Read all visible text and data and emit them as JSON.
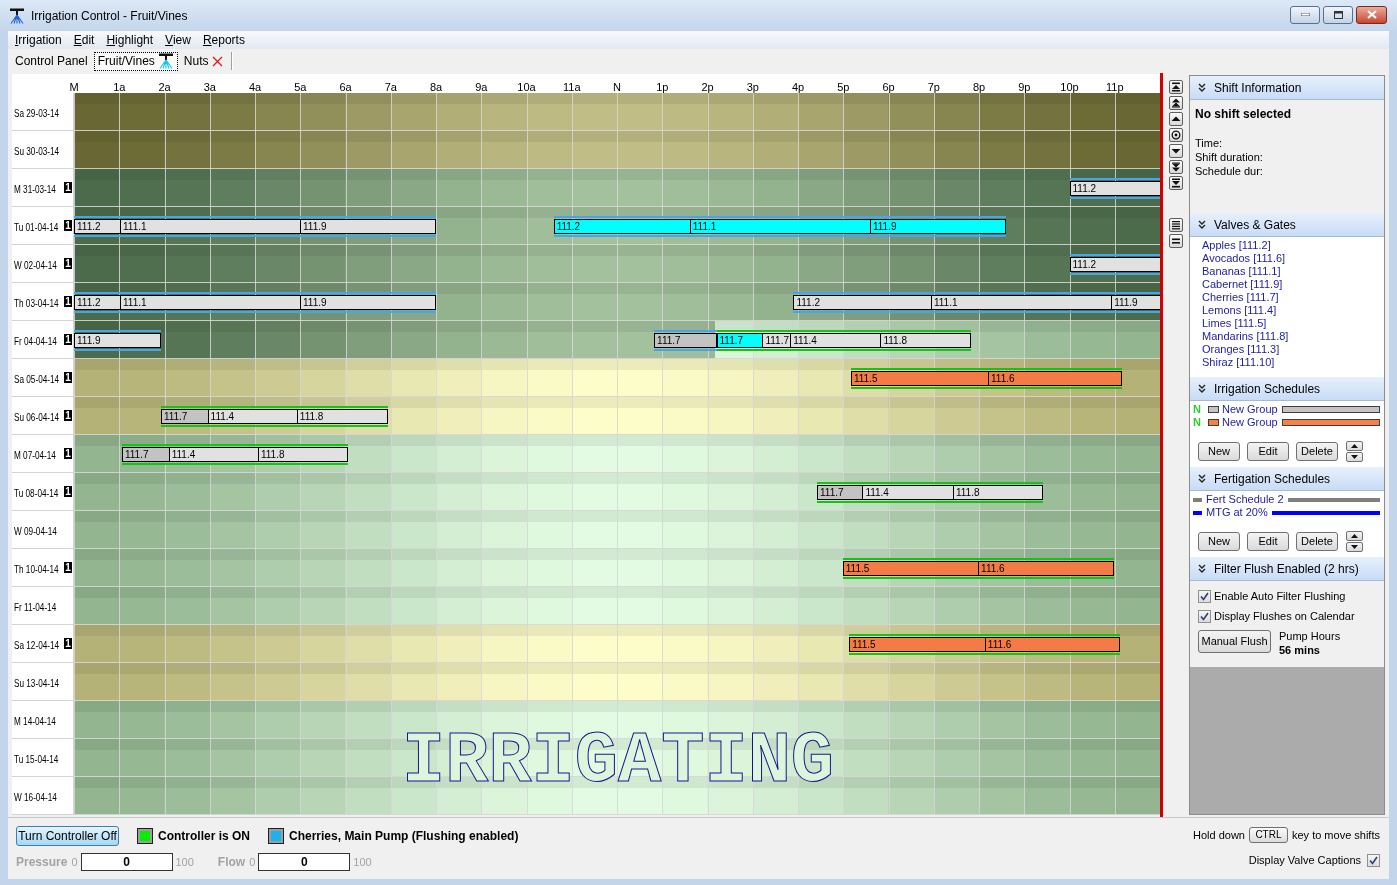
{
  "window": {
    "title": "Irrigation Control - Fruit/Vines"
  },
  "menu": [
    "Irrigation",
    "Edit",
    "Highlight",
    "View",
    "Reports"
  ],
  "tabs": [
    {
      "label": "Control Panel",
      "selected": false,
      "kind": "plain"
    },
    {
      "label": "Fruit/Vines",
      "selected": true,
      "kind": "sprinkler"
    },
    {
      "label": "Nuts",
      "selected": false,
      "kind": "closable"
    }
  ],
  "calendar": {
    "hours": [
      "M",
      "1a",
      "2a",
      "3a",
      "4a",
      "5a",
      "6a",
      "7a",
      "8a",
      "9a",
      "10a",
      "11a",
      "N",
      "1p",
      "2p",
      "3p",
      "4p",
      "5p",
      "6p",
      "7p",
      "8p",
      "9p",
      "10p",
      "11p"
    ],
    "rows": [
      {
        "label": "Sa 29-03-14",
        "kind": "weekend",
        "level": 1
      },
      {
        "label": "Su 30-03-14",
        "kind": "weekend",
        "level": 1
      },
      {
        "label": "M 31-03-14",
        "kind": "weekday",
        "level": 1,
        "badge": "1",
        "shifts": [
          {
            "color": "#e1e1e1",
            "band": {
              "color": "#43a6ee"
            },
            "segments": [
              {
                "label": "111.2",
                "kind": "plain"
              }
            ]
          }
        ]
      },
      {
        "label": "Tu 01-04-14",
        "kind": "weekday",
        "level": 1,
        "badge": "1",
        "shifts": [
          {
            "color": "#e1e1e1",
            "band": {
              "color": "#43a6ee"
            },
            "segments": [
              {
                "label": "111.2",
                "kind": "plain"
              },
              {
                "label": "111.1",
                "kind": "plain"
              },
              {
                "label": "111.9",
                "kind": "plain"
              }
            ]
          },
          {
            "band": {
              "color": "#43a6ee"
            },
            "segments": [
              {
                "label": "111.2",
                "kind": "active"
              },
              {
                "label": "111.1",
                "kind": "active"
              },
              {
                "label": "111.9",
                "kind": "active"
              }
            ]
          }
        ]
      },
      {
        "label": "W 02-04-14",
        "kind": "weekday",
        "level": 1,
        "badge": "1",
        "shifts": [
          {
            "color": "#e1e1e1",
            "band": {
              "color": "#43a6ee"
            },
            "segments": [
              {
                "label": "111.2",
                "kind": "plain"
              }
            ]
          }
        ]
      },
      {
        "label": "Th 03-04-14",
        "kind": "weekday",
        "level": 1,
        "badge": "1",
        "shifts": [
          {
            "color": "#e1e1e1",
            "band": {
              "color": "#43a6ee"
            },
            "segments": [
              {
                "label": "111.2",
                "kind": "plain"
              },
              {
                "label": "111.1",
                "kind": "plain"
              },
              {
                "label": "111.9",
                "kind": "plain"
              }
            ]
          },
          {
            "color": "#e1e1e1",
            "band": {
              "color": "#43a6ee"
            },
            "segments": [
              {
                "label": "111.2",
                "kind": "plain"
              },
              {
                "label": "111.1",
                "kind": "plain"
              },
              {
                "label": "111.9",
                "kind": "plain"
              }
            ]
          }
        ]
      },
      {
        "label": "Fr 04-04-14",
        "kind": "weekday",
        "level": 0.59,
        "badge": "1",
        "shifts": [
          {
            "color": "#e1e1e1",
            "band": {
              "color": "#43a6ee"
            },
            "segments": [
              {
                "label": "111.9",
                "kind": "plain"
              }
            ]
          },
          {
            "band": {
              "color": "#43a6ee"
            },
            "segments": [
              {
                "label": "111.7",
                "kind": "shaded"
              }
            ]
          },
          {
            "color": "#e1e1e1",
            "band": {
              "color": "#14c414"
            },
            "segments": [
              {
                "label": "111.7",
                "kind": "active"
              },
              {
                "label": "111.7",
                "kind": "plain"
              },
              {
                "label": "111.4",
                "kind": "plain"
              },
              {
                "label": "111.8",
                "kind": "plain"
              }
            ]
          }
        ]
      },
      {
        "label": "Sa 05-04-14",
        "kind": "weekend",
        "badge": "1",
        "shifts": [
          {
            "color": "#f57b46",
            "band": {
              "color": "#14c414"
            },
            "segments": [
              {
                "label": "111.5",
                "kind": "plain"
              },
              {
                "label": "111.6",
                "kind": "plain"
              }
            ]
          }
        ]
      },
      {
        "label": "Su 06-04-14",
        "kind": "weekend",
        "badge": "1",
        "shifts": [
          {
            "color": "#e1e1e1",
            "band": {
              "color": "#14c414"
            },
            "segments": [
              {
                "label": "111.7",
                "kind": "shaded"
              },
              {
                "label": "111.4",
                "kind": "plain"
              },
              {
                "label": "111.8",
                "kind": "plain"
              }
            ]
          }
        ]
      },
      {
        "label": "M 07-04-14",
        "kind": "weekday",
        "badge": "1",
        "shifts": [
          {
            "color": "#e1e1e1",
            "band": {
              "color": "#14c414"
            },
            "segments": [
              {
                "label": "111.7",
                "kind": "shaded"
              },
              {
                "label": "111.4",
                "kind": "plain"
              },
              {
                "label": "111.8",
                "kind": "plain"
              }
            ]
          }
        ]
      },
      {
        "label": "Tu 08-04-14",
        "kind": "weekday",
        "badge": "1",
        "shifts": [
          {
            "color": "#e1e1e1",
            "band": {
              "color": "#14c414"
            },
            "segments": [
              {
                "label": "111.7",
                "kind": "shaded"
              },
              {
                "label": "111.4",
                "kind": "plain"
              },
              {
                "label": "111.8",
                "kind": "plain"
              }
            ]
          }
        ]
      },
      {
        "label": "W 09-04-14",
        "kind": "weekday"
      },
      {
        "label": "Th 10-04-14",
        "kind": "weekday",
        "badge": "1",
        "shifts": [
          {
            "color": "#f57b46",
            "band": {
              "color": "#14c414"
            },
            "segments": [
              {
                "label": "111.5",
                "kind": "plain"
              },
              {
                "label": "111.6",
                "kind": "plain"
              }
            ]
          }
        ]
      },
      {
        "label": "Fr 11-04-14",
        "kind": "weekday"
      },
      {
        "label": "Sa 12-04-14",
        "kind": "weekend",
        "badge": "1",
        "shifts": [
          {
            "color": "#f57b46",
            "band": {
              "color": "#14c414"
            },
            "segments": [
              {
                "label": "111.5",
                "kind": "plain"
              },
              {
                "label": "111.6",
                "kind": "plain"
              }
            ]
          }
        ]
      },
      {
        "label": "Su 13-04-14",
        "kind": "weekend"
      },
      {
        "label": "M 14-04-14",
        "kind": "weekday"
      },
      {
        "label": "Tu 15-04-14",
        "kind": "weekday"
      },
      {
        "label": "W 16-04-14",
        "kind": "weekday"
      }
    ],
    "status_text": "IRRIGATING"
  },
  "side_panel": {
    "shift_info": {
      "title": "Shift Information",
      "heading": "No shift selected",
      "fields": [
        "Time:",
        "Shift duration:",
        "Schedule dur:"
      ]
    },
    "valves": {
      "title": "Valves & Gates",
      "items": [
        "Apples [111.2]",
        "Avocados [111.6]",
        "Bananas [111.1]",
        "Cabernet [111.9]",
        "Cherries [111.7]",
        "Lemons [111.4]",
        "Limes [111.5]",
        "Mandarins [111.8]",
        "Oranges [111.3]",
        "Shiraz [111.10]"
      ]
    },
    "irrigation_schedules": {
      "title": "Irrigation Schedules",
      "items": [
        {
          "flag": "N",
          "label": "New Group",
          "color": "#c4c4c4"
        },
        {
          "flag": "N",
          "label": "New Group",
          "color": "#fb7e48"
        }
      ],
      "buttons": [
        "New",
        "Edit",
        "Delete"
      ]
    },
    "fertigation_schedules": {
      "title": "Fertigation Schedules",
      "items": [
        {
          "label": "Fert Schedule 2",
          "color": "#7f7f7f"
        },
        {
          "label": "MTG at 20%",
          "color": "#0000ff"
        }
      ],
      "buttons": [
        "New",
        "Edit",
        "Delete"
      ]
    },
    "filter_flush": {
      "title": "Filter Flush Enabled (2 hrs)",
      "options": [
        {
          "label": "Enable Auto Filter Flushing",
          "checked": true
        },
        {
          "label": "Display Flushes on Calendar",
          "checked": true
        }
      ],
      "button": "Manual Flush",
      "pump_hours_label": "Pump Hours",
      "pump_hours_value": "56 mins"
    }
  },
  "status_bar": {
    "toggle_button": "Turn Controller Off",
    "indicators": [
      {
        "label": "Controller is ON",
        "color": "#00f000"
      },
      {
        "label": "Cherries, Main Pump (Flushing enabled)",
        "color": "#18b4f2"
      }
    ],
    "gauges": [
      {
        "label": "Pressure",
        "min": "0",
        "value": "0",
        "max": "100",
        "disabled": true
      },
      {
        "label": "Flow",
        "min": "0",
        "value": "0",
        "max": "100",
        "disabled": true
      }
    ],
    "hint": {
      "before": "Hold down",
      "key": "CTRL",
      "after": "key to move shifts"
    },
    "captions": {
      "label": "Display Valve Captions",
      "checked": true
    }
  }
}
